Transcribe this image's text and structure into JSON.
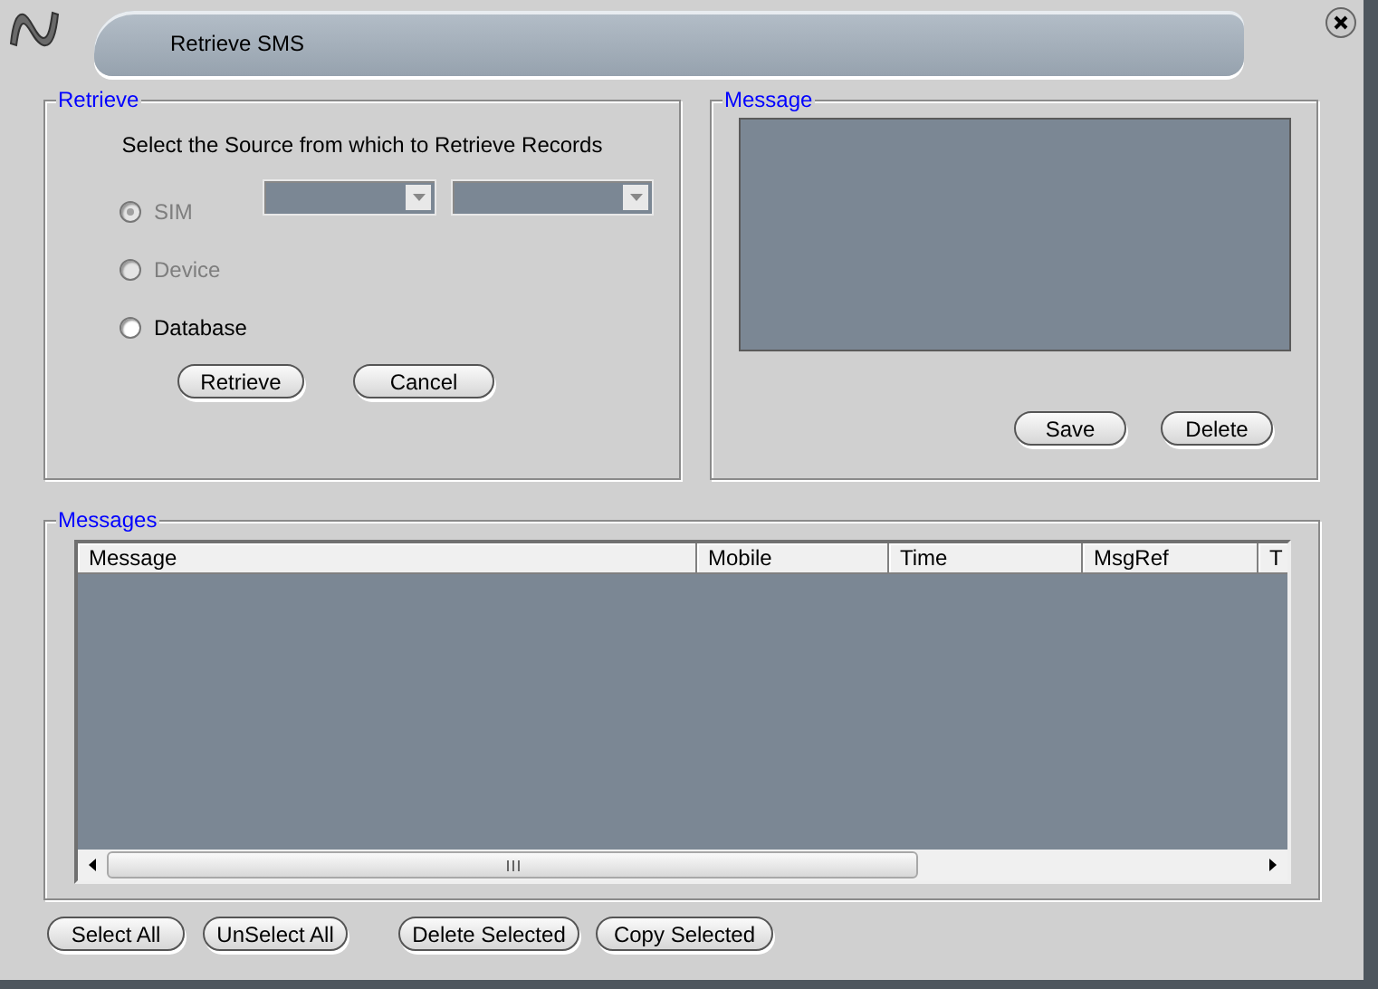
{
  "window": {
    "title": "Retrieve SMS"
  },
  "retrieve": {
    "legend": "Retrieve",
    "prompt": "Select the Source from which to Retrieve Records",
    "sources": [
      {
        "label": "SIM",
        "selected": true,
        "disabled": true
      },
      {
        "label": "Device",
        "selected": false,
        "disabled": true
      },
      {
        "label": "Database",
        "selected": false,
        "disabled": false
      }
    ],
    "dropdowns": [
      {
        "disabled": true
      },
      {
        "disabled": true
      }
    ],
    "buttons": [
      "Retrieve",
      "Cancel"
    ]
  },
  "message": {
    "legend": "Message",
    "buttons": [
      "Save",
      "Delete"
    ]
  },
  "messages": {
    "legend": "Messages",
    "columns": [
      "Message",
      "Mobile",
      "Time",
      "MsgRef",
      "T"
    ]
  },
  "buttons": [
    "Select All",
    "UnSelect All",
    "Delete Selected",
    "Copy Selected"
  ]
}
